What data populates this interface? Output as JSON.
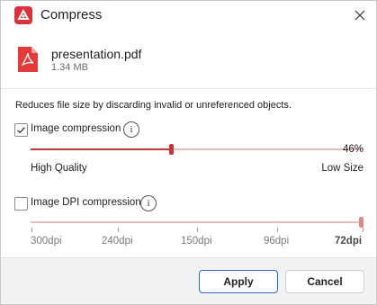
{
  "window": {
    "title": "Compress",
    "icons": {
      "app": "pdf-app-icon",
      "close": "close-icon"
    }
  },
  "file": {
    "name": "presentation.pdf",
    "size": "1.34 MB",
    "icon": "pdf-file-icon"
  },
  "description": "Reduces file size by discarding invalid or unreferenced objects.",
  "image_compression": {
    "label": "Image compression",
    "checked": true,
    "info_glyph": "i",
    "value_percent": 46,
    "value_label": "46%",
    "min_label": "High Quality",
    "max_label": "Low Size"
  },
  "dpi_compression": {
    "label": "Image DPI compression",
    "checked": false,
    "info_glyph": "i",
    "options": [
      "300dpi",
      "240dpi",
      "150dpi",
      "96dpi",
      "72dpi"
    ],
    "selected": "72dpi"
  },
  "buttons": {
    "apply": "Apply",
    "cancel": "Cancel"
  },
  "colors": {
    "accent": "#c0393b",
    "track": "#e6bcbc",
    "primary_border": "#2f66c9"
  }
}
